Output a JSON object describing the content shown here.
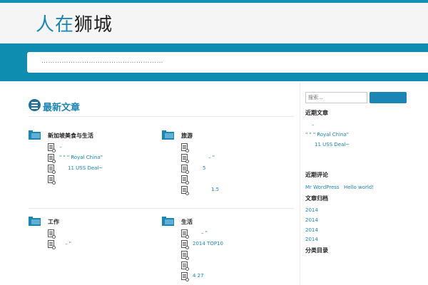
{
  "site": {
    "logo_part1": "人在",
    "logo_part2": "狮城"
  },
  "banner": {
    "text": "………………………………………………"
  },
  "main": {
    "title": "最新文章",
    "categories": [
      {
        "title": "新加坡美食与生活",
        "posts": [
          "–",
          "\" \"  \" Royal China\"",
          "11 USS Deal~",
          ""
        ]
      },
      {
        "title": "旅游",
        "posts": [
          "",
          "– \"",
          "5",
          "",
          "1.5"
        ]
      },
      {
        "title": "工作",
        "posts": [
          "",
          "– \""
        ]
      },
      {
        "title": "生活",
        "posts": [
          "– \"",
          "2014 TOP10",
          "",
          "",
          "4 27"
        ]
      }
    ]
  },
  "sidebar": {
    "search": {
      "placeholder": "搜索..."
    },
    "recent_posts": {
      "title": "近期文章",
      "items": [
        "–",
        "\" \"  \" Royal China\"",
        "11 USS Deal~"
      ]
    },
    "recent_comments": {
      "title": "近期评论",
      "items": [
        "Mr WordPress",
        "Hello world!"
      ]
    },
    "archives": {
      "title": "文章归档",
      "items": [
        "2014",
        "2014",
        "2014",
        "2014"
      ]
    },
    "categories": {
      "title": "分类目录"
    }
  },
  "colors": {
    "accent": "#1a86b5",
    "band": "#0f8db1"
  }
}
